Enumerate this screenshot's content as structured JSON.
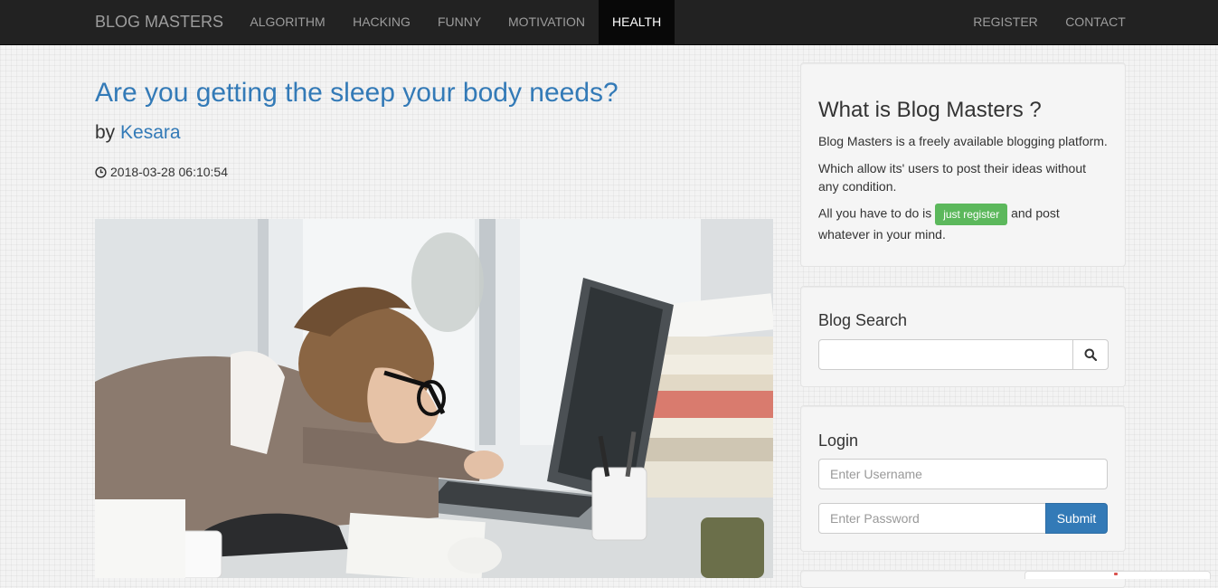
{
  "navbar": {
    "brand": "BLOG MASTERS",
    "items": [
      {
        "label": "ALGORITHM",
        "active": false
      },
      {
        "label": "HACKING",
        "active": false
      },
      {
        "label": "FUNNY",
        "active": false
      },
      {
        "label": "MOTIVATION",
        "active": false
      },
      {
        "label": "HEALTH",
        "active": true
      }
    ],
    "right_items": [
      {
        "label": "REGISTER"
      },
      {
        "label": "CONTACT"
      }
    ]
  },
  "post": {
    "title": "Are you getting the sleep your body needs?",
    "byline_prefix": "by",
    "author": "Kesara",
    "timestamp": "2018-03-28 06:10:54"
  },
  "sidebar": {
    "about": {
      "title": "What is Blog Masters ?",
      "p1": "Blog Masters is a freely available blogging platform.",
      "p2": "Which allow its' users to post their ideas without any condition.",
      "p3_before": "All you have to do is",
      "register_badge": "just register",
      "p3_after_line1": "and post",
      "p3_after_line2": "whatever in your mind."
    },
    "search": {
      "title": "Blog Search",
      "value": ""
    },
    "login": {
      "title": "Login",
      "username_placeholder": "Enter Username",
      "password_placeholder": "Enter Password",
      "submit_label": "Submit"
    }
  },
  "colors": {
    "navbar_bg": "#222222",
    "link": "#337ab7",
    "badge": "#5cb85c",
    "submit": "#337ab7"
  }
}
